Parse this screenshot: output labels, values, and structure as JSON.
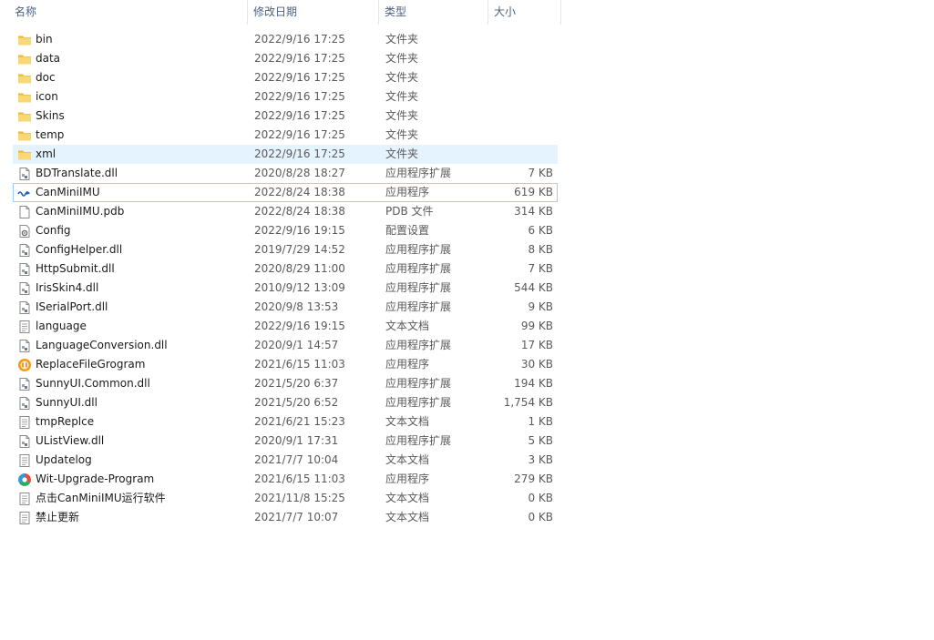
{
  "columns": {
    "name": "名称",
    "date": "修改日期",
    "type": "类型",
    "size": "大小"
  },
  "rows": [
    {
      "name": "bin",
      "date": "2022/9/16 17:25",
      "type": "文件夹",
      "size": "",
      "icon": "folder-icon"
    },
    {
      "name": "data",
      "date": "2022/9/16 17:25",
      "type": "文件夹",
      "size": "",
      "icon": "folder-icon"
    },
    {
      "name": "doc",
      "date": "2022/9/16 17:25",
      "type": "文件夹",
      "size": "",
      "icon": "folder-icon"
    },
    {
      "name": "icon",
      "date": "2022/9/16 17:25",
      "type": "文件夹",
      "size": "",
      "icon": "folder-icon"
    },
    {
      "name": "Skins",
      "date": "2022/9/16 17:25",
      "type": "文件夹",
      "size": "",
      "icon": "folder-icon"
    },
    {
      "name": "temp",
      "date": "2022/9/16 17:25",
      "type": "文件夹",
      "size": "",
      "icon": "folder-icon"
    },
    {
      "name": "xml",
      "date": "2022/9/16 17:25",
      "type": "文件夹",
      "size": "",
      "icon": "folder-icon",
      "state": "hover"
    },
    {
      "name": "BDTranslate.dll",
      "date": "2020/8/28 18:27",
      "type": "应用程序扩展",
      "size": "7 KB",
      "icon": "dll-icon"
    },
    {
      "name": "CanMiniIMU",
      "date": "2022/8/24 18:38",
      "type": "应用程序",
      "size": "619 KB",
      "icon": "app-wave-icon",
      "state": "focus"
    },
    {
      "name": "CanMiniIMU.pdb",
      "date": "2022/8/24 18:38",
      "type": "PDB 文件",
      "size": "314 KB",
      "icon": "blank-file-icon"
    },
    {
      "name": "Config",
      "date": "2022/9/16 19:15",
      "type": "配置设置",
      "size": "6 KB",
      "icon": "config-file-icon"
    },
    {
      "name": "ConfigHelper.dll",
      "date": "2019/7/29 14:52",
      "type": "应用程序扩展",
      "size": "8 KB",
      "icon": "dll-icon"
    },
    {
      "name": "HttpSubmit.dll",
      "date": "2020/8/29 11:00",
      "type": "应用程序扩展",
      "size": "7 KB",
      "icon": "dll-icon"
    },
    {
      "name": "IrisSkin4.dll",
      "date": "2010/9/12 13:09",
      "type": "应用程序扩展",
      "size": "544 KB",
      "icon": "dll-icon"
    },
    {
      "name": "ISerialPort.dll",
      "date": "2020/9/8 13:53",
      "type": "应用程序扩展",
      "size": "9 KB",
      "icon": "dll-icon"
    },
    {
      "name": "language",
      "date": "2022/9/16 19:15",
      "type": "文本文档",
      "size": "99 KB",
      "icon": "text-file-icon"
    },
    {
      "name": "LanguageConversion.dll",
      "date": "2020/9/1 14:57",
      "type": "应用程序扩展",
      "size": "17 KB",
      "icon": "dll-icon"
    },
    {
      "name": "ReplaceFileGrogram",
      "date": "2021/6/15 11:03",
      "type": "应用程序",
      "size": "30 KB",
      "icon": "app-orange-icon"
    },
    {
      "name": "SunnyUI.Common.dll",
      "date": "2021/5/20 6:37",
      "type": "应用程序扩展",
      "size": "194 KB",
      "icon": "dll-icon"
    },
    {
      "name": "SunnyUI.dll",
      "date": "2021/5/20 6:52",
      "type": "应用程序扩展",
      "size": "1,754 KB",
      "icon": "dll-icon"
    },
    {
      "name": "tmpReplce",
      "date": "2021/6/21 15:23",
      "type": "文本文档",
      "size": "1 KB",
      "icon": "text-file-icon"
    },
    {
      "name": "UListView.dll",
      "date": "2020/9/1 17:31",
      "type": "应用程序扩展",
      "size": "5 KB",
      "icon": "dll-icon"
    },
    {
      "name": "Updatelog",
      "date": "2021/7/7 10:04",
      "type": "文本文档",
      "size": "3 KB",
      "icon": "text-file-icon"
    },
    {
      "name": "Wit-Upgrade-Program",
      "date": "2021/6/15 11:03",
      "type": "应用程序",
      "size": "279 KB",
      "icon": "app-color-icon"
    },
    {
      "name": "点击CanMiniIMU运行软件",
      "date": "2021/11/8 15:25",
      "type": "文本文档",
      "size": "0 KB",
      "icon": "text-file-icon"
    },
    {
      "name": "禁止更新",
      "date": "2021/7/7 10:07",
      "type": "文本文档",
      "size": "0 KB",
      "icon": "text-file-icon"
    }
  ],
  "colors": {
    "hover_bg": "#e5f3ff",
    "focus_border": "#99d1ff",
    "header_text": "#4d6082",
    "folder": "#f8d775"
  }
}
